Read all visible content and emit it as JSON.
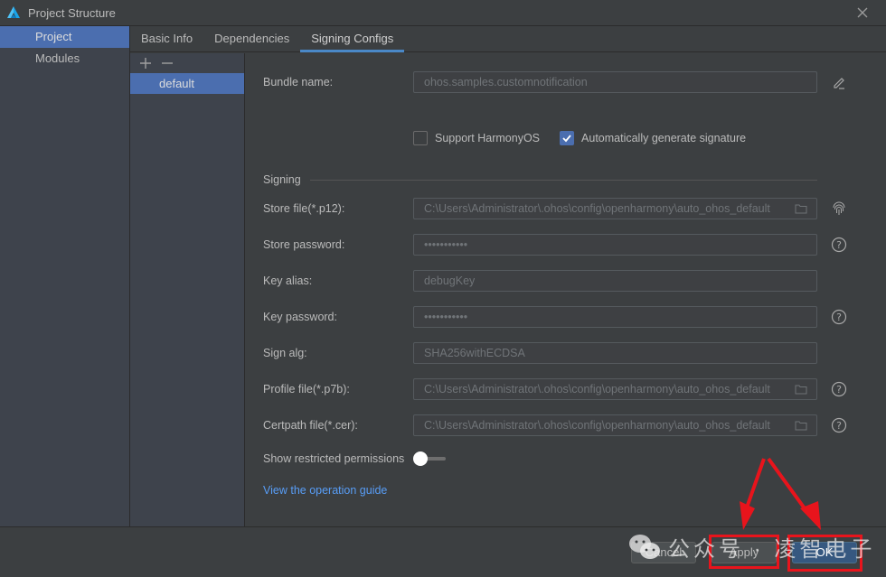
{
  "window": {
    "title": "Project Structure",
    "close_icon": "close-icon"
  },
  "sidebar": {
    "items": [
      {
        "label": "Project",
        "selected": true
      },
      {
        "label": "Modules",
        "selected": false
      }
    ]
  },
  "tabs": [
    {
      "label": "Basic Info",
      "active": false
    },
    {
      "label": "Dependencies",
      "active": false
    },
    {
      "label": "Signing Configs",
      "active": true
    }
  ],
  "config_list": {
    "add_icon": "plus-icon",
    "remove_icon": "minus-icon",
    "items": [
      {
        "label": "default",
        "selected": true
      }
    ]
  },
  "form": {
    "bundle_name": {
      "label": "Bundle name:",
      "value": "ohos.samples.customnotification",
      "icon": "pencil-icon"
    },
    "support_harmonyos": {
      "label": "Support HarmonyOS",
      "checked": false
    },
    "auto_signature": {
      "label": "Automatically generate signature",
      "checked": true
    },
    "signing_section": "Signing",
    "store_file": {
      "label": "Store file(*.p12):",
      "value": "C:\\Users\\Administrator\\.ohos\\config\\openharmony\\auto_ohos_default",
      "icon": "fingerprint-icon"
    },
    "store_password": {
      "label": "Store password:",
      "value": "•••••••••••",
      "icon": "help-icon"
    },
    "key_alias": {
      "label": "Key alias:",
      "value": "debugKey"
    },
    "key_password": {
      "label": "Key password:",
      "value": "•••••••••••",
      "icon": "help-icon"
    },
    "sign_alg": {
      "label": "Sign alg:",
      "value": "SHA256withECDSA"
    },
    "profile_file": {
      "label": "Profile file(*.p7b):",
      "value": "C:\\Users\\Administrator\\.ohos\\config\\openharmony\\auto_ohos_default",
      "icon": "help-icon"
    },
    "certpath_file": {
      "label": "Certpath file(*.cer):",
      "value": "C:\\Users\\Administrator\\.ohos\\config\\openharmony\\auto_ohos_default",
      "icon": "help-icon"
    },
    "show_restricted": {
      "label": "Show restricted permissions",
      "on": false
    },
    "guide_link": "View the operation guide"
  },
  "footer": {
    "cancel": "Cancel",
    "apply": "Apply",
    "ok": "OK"
  },
  "overlay": {
    "watermark": "公众号 · 凌智电子",
    "highlight_color": "#e8141c"
  },
  "colors": {
    "accent": "#4b6eaf",
    "link": "#589df6",
    "primary_button": "#365880",
    "tab_underline": "#4a88c7"
  }
}
